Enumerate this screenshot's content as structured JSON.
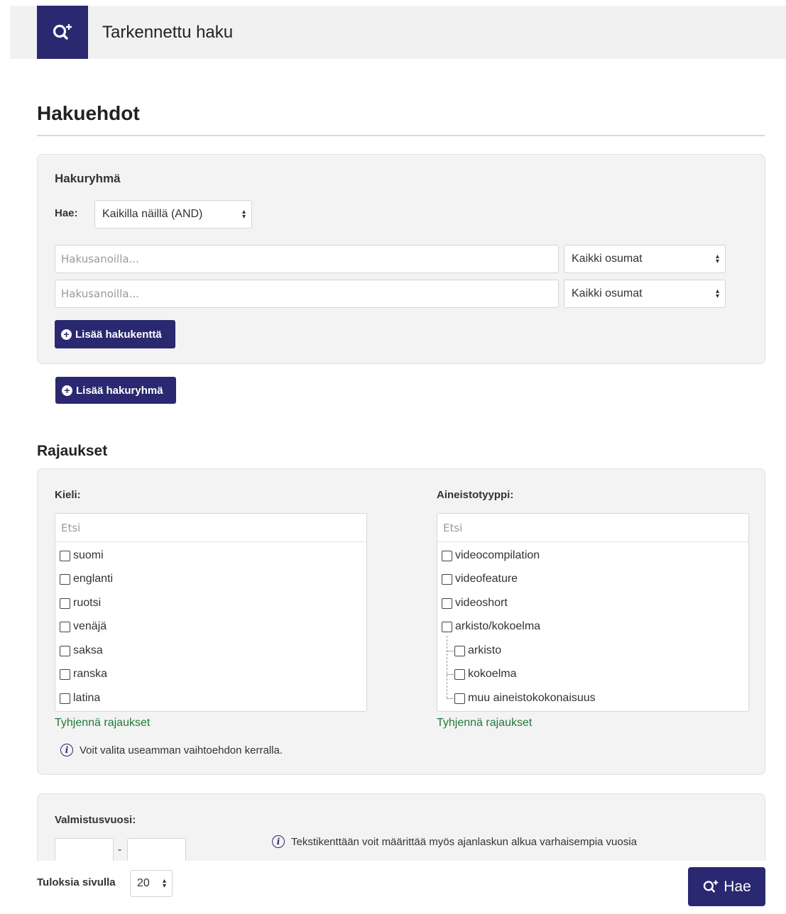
{
  "header": {
    "title": "Tarkennettu haku",
    "icon": "search-plus-icon"
  },
  "conditions": {
    "heading": "Hakuehdot",
    "group": {
      "title": "Hakuryhmä",
      "hae_label": "Hae:",
      "match_select": "Kaikilla näillä (AND)",
      "fields": [
        {
          "placeholder": "Hakusanoilla...",
          "type": "Kaikki osumat"
        },
        {
          "placeholder": "Hakusanoilla...",
          "type": "Kaikki osumat"
        }
      ],
      "add_field_label": "Lisää hakukenttä"
    },
    "add_group_label": "Lisää hakuryhmä"
  },
  "limits": {
    "heading": "Rajaukset",
    "language": {
      "label": "Kieli:",
      "search_placeholder": "Etsi",
      "options": [
        "suomi",
        "englanti",
        "ruotsi",
        "venäjä",
        "saksa",
        "ranska",
        "latina"
      ],
      "clear_label": "Tyhjennä rajaukset"
    },
    "material": {
      "label": "Aineistotyyppi:",
      "search_placeholder": "Etsi",
      "options": [
        "videocompilation",
        "videofeature",
        "videoshort",
        "arkisto/kokoelma"
      ],
      "sub_options": [
        "arkisto",
        "kokoelma",
        "muu aineistokokonaisuus"
      ],
      "clear_label": "Tyhjennä rajaukset"
    },
    "info": "Voit valita useamman vaihtoehdon kerralla."
  },
  "year": {
    "label": "Valmistusvuosi:",
    "separator": "-",
    "info": "Tekstikenttään voit määrittää myös ajanlaskun alkua varhaisempia vuosia"
  },
  "footer": {
    "per_page_label": "Tuloksia sivulla",
    "per_page_value": "20",
    "search_button": "Hae"
  },
  "colors": {
    "primary": "#2a2870",
    "link": "#1f7a3a",
    "panel": "#f3f3f3"
  }
}
